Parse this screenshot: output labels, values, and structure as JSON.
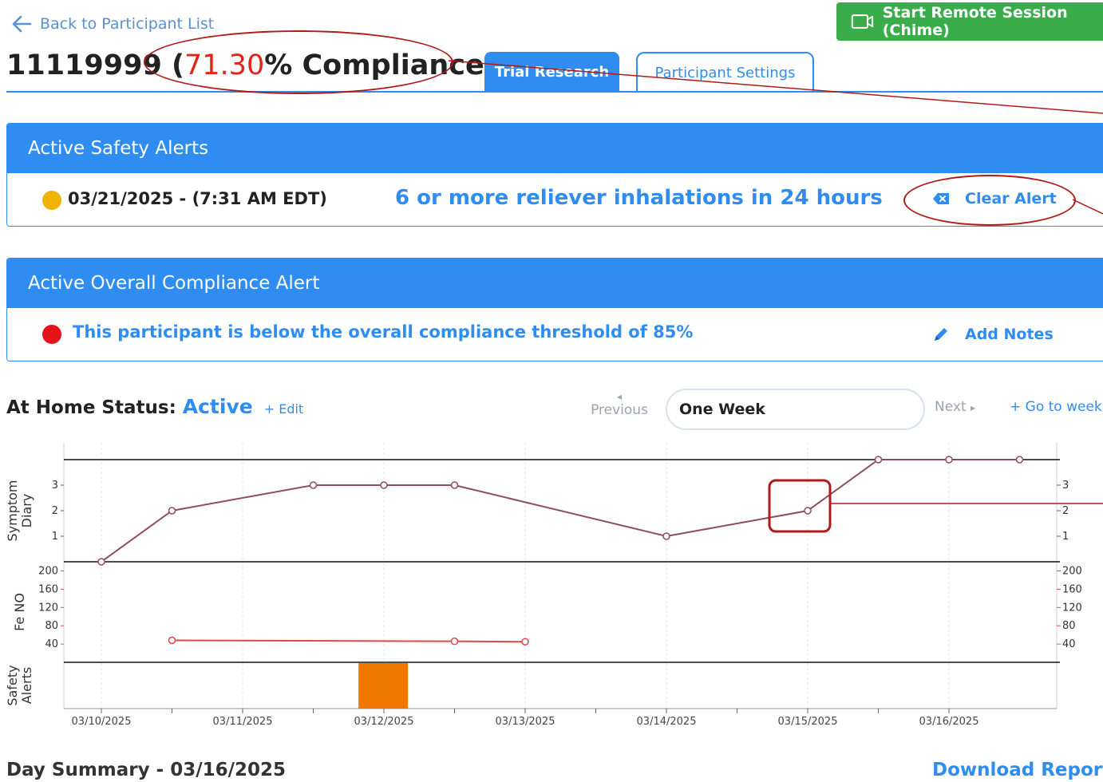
{
  "nav": {
    "back_label": "Back to Participant List"
  },
  "remote_session": {
    "label": "Start Remote Session (Chime)"
  },
  "participant": {
    "id": "11119999",
    "title_open": " (",
    "compliance_pct": "71.30",
    "compliance_suffix": "% Compliance)"
  },
  "tabs": [
    {
      "label": "Trial Research",
      "active": true
    },
    {
      "label": "Participant Settings",
      "active": false
    }
  ],
  "safety_alerts": {
    "header": "Active Safety Alerts",
    "items": [
      {
        "date": "03/21/2025 - (7:31 AM EDT)",
        "message": "6 or more reliever inhalations in 24 hours",
        "action": "Clear Alert",
        "dot_color": "#f0b400"
      }
    ]
  },
  "compliance_alert": {
    "header": "Active Overall Compliance Alert",
    "message": "This participant is below the overall compliance threshold of 85%",
    "action": "Add Notes",
    "dot_color": "#e8121c"
  },
  "home_status": {
    "label": "At Home Status:",
    "value": "Active",
    "edit": "+ Edit"
  },
  "week_nav": {
    "previous": "Previous",
    "selected": "One Week",
    "next": "Next",
    "goto": "+ Go to week"
  },
  "colors": {
    "accent": "#2f8cf0",
    "success": "#3aac4a",
    "danger": "#e2231a",
    "annotation": "#b01a1a"
  },
  "chart_data": {
    "type": "line",
    "x_labels": [
      "03/10/2025",
      "03/11/2025",
      "03/12/2025",
      "03/13/2025",
      "03/14/2025",
      "03/15/2025",
      "03/16/2025"
    ],
    "panels": [
      {
        "name": "Symptom Diary",
        "label_lines": [
          "Symptom",
          "Diary"
        ],
        "ylim": [
          0,
          4
        ],
        "ticks": [
          1,
          2,
          3
        ],
        "color": "#8e4c5c",
        "points": [
          {
            "x": 0,
            "y": 0
          },
          {
            "x": 0.5,
            "y": 2
          },
          {
            "x": 1.5,
            "y": 3
          },
          {
            "x": 2,
            "y": 3
          },
          {
            "x": 2.5,
            "y": 3
          },
          {
            "x": 4,
            "y": 1
          },
          {
            "x": 5,
            "y": 2
          },
          {
            "x": 5.5,
            "y": 4
          },
          {
            "x": 6,
            "y": 4
          },
          {
            "x": 6.5,
            "y": 4
          }
        ],
        "highlight_index": 6
      },
      {
        "name": "Fe NO",
        "label_lines": [
          "Fe NO"
        ],
        "ylim": [
          0,
          220
        ],
        "ticks": [
          40,
          80,
          120,
          160,
          200
        ],
        "color": "#d94a4a",
        "points": [
          {
            "x": 0.5,
            "y": 48
          },
          {
            "x": 2.5,
            "y": 46
          },
          {
            "x": 3,
            "y": 45
          }
        ]
      },
      {
        "name": "Safety Alerts",
        "label_lines": [
          "Safety",
          "Alerts"
        ],
        "bars": [
          {
            "x_start": 1.82,
            "x_end": 2.17,
            "color": "#f07800"
          }
        ]
      }
    ]
  },
  "day_summary": {
    "title": "Day Summary - 03/16/2025",
    "download": "Download Report"
  }
}
